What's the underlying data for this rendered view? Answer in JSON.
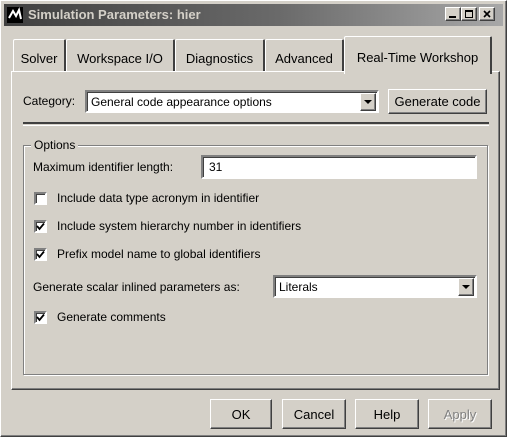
{
  "window": {
    "title": "Simulation Parameters: hier"
  },
  "tabs": [
    {
      "label": "Solver",
      "active": false
    },
    {
      "label": "Workspace I/O",
      "active": false
    },
    {
      "label": "Diagnostics",
      "active": false
    },
    {
      "label": "Advanced",
      "active": false
    },
    {
      "label": "Real-Time Workshop",
      "active": true
    }
  ],
  "category": {
    "label": "Category:",
    "selected": "General code appearance options",
    "button_label": "Generate code"
  },
  "options": {
    "group_title": "Options",
    "max_identifier_label": "Maximum identifier length:",
    "max_identifier_value": "31",
    "checkboxes": [
      {
        "label": "Include data type acronym in identifier",
        "checked": false
      },
      {
        "label": "Include system hierarchy number in identifiers",
        "checked": true
      },
      {
        "label": "Prefix model name to global identifiers",
        "checked": true
      }
    ],
    "scalar_label": "Generate scalar inlined parameters as:",
    "scalar_selected": "Literals",
    "comments": {
      "label": "Generate comments",
      "checked": true
    }
  },
  "buttons": {
    "ok": "OK",
    "cancel": "Cancel",
    "help": "Help",
    "apply": "Apply"
  },
  "icons": {
    "app": "matlab-simulink-icon",
    "minimize": "minimize-icon",
    "maximize": "maximize-icon",
    "close": "close-icon"
  }
}
